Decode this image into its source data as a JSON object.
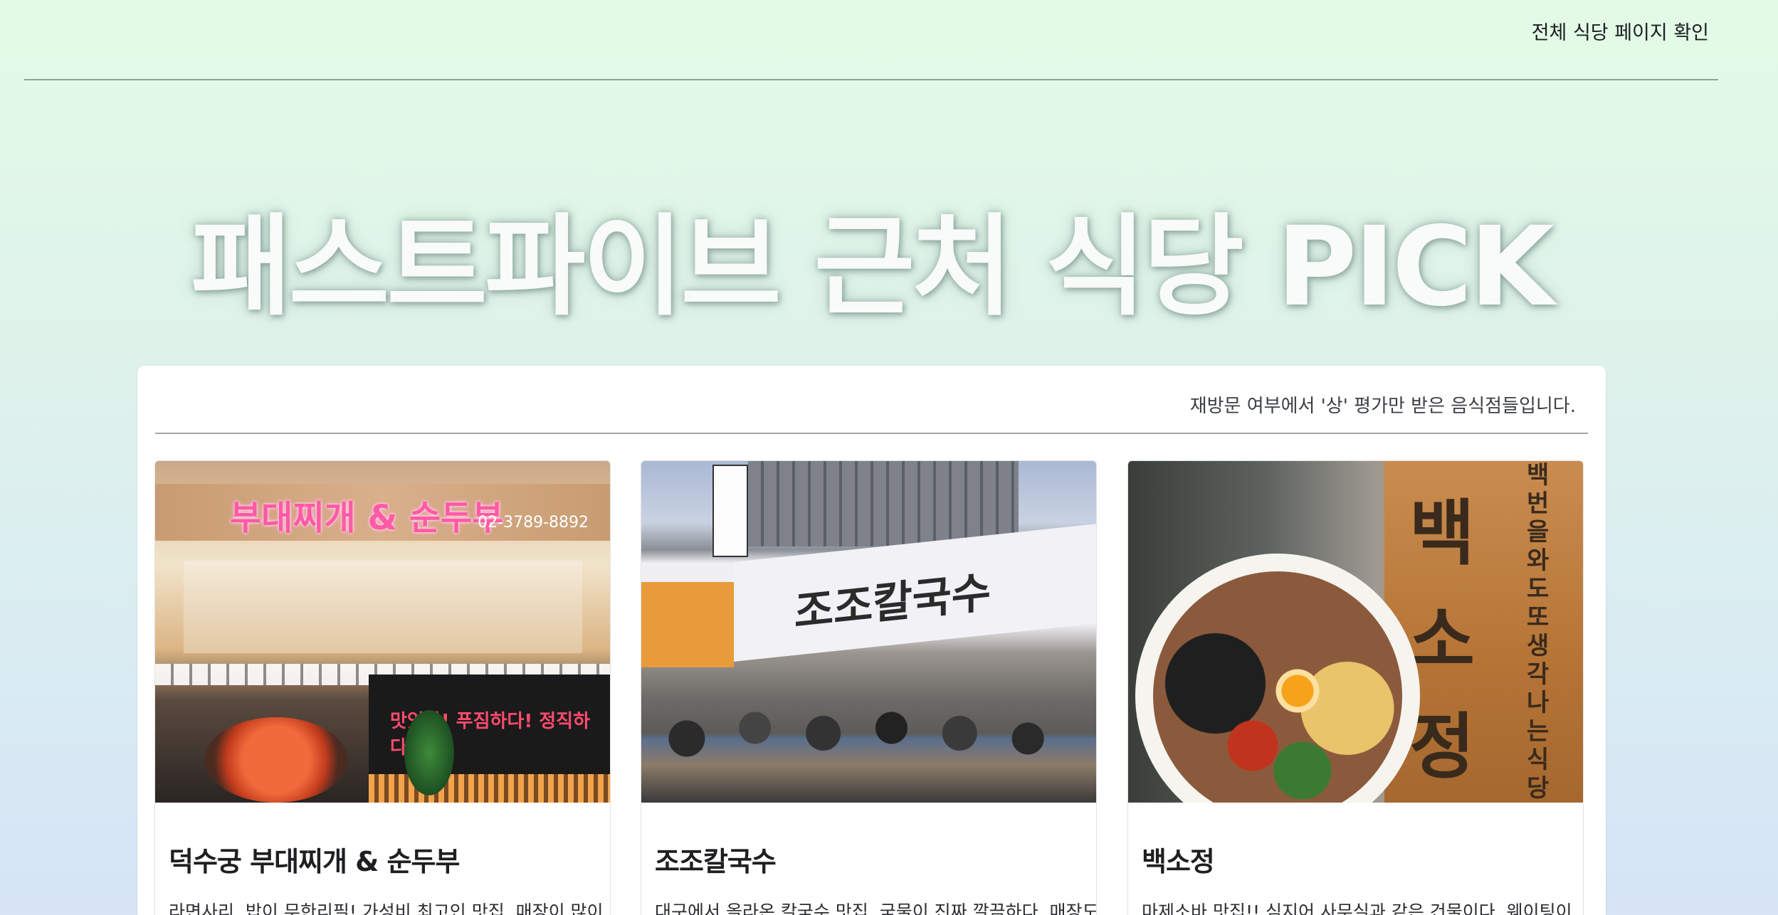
{
  "nav": {
    "link_label": "전체 식당 페이지 확인"
  },
  "hero": {
    "title": "패스트파이브 근처 식당 PICK"
  },
  "panel": {
    "subtitle": "재방문 여부에서 '상' 평가만 받은 음식점들입니다."
  },
  "cards": [
    {
      "title": "덕수궁 부대찌개 & 순두부",
      "description": "라면사리, 밥이 무한리필! 가성비 최고인 맛집. 매장이 많이",
      "image_sign": "부대찌개 & 순두부",
      "image_phone": "02-3789-8892",
      "image_board": "맛있다! 푸짐하다! 정직하다!"
    },
    {
      "title": "조조칼국수",
      "description": "대구에서 올라온 칼국수 맛집. 국물이 진짜 깔끔하다. 매장도",
      "image_sign": "조조칼국수"
    },
    {
      "title": "백소정",
      "description": "마제소바 맛집!! 심지어 사무실과 같은 건물이다. 웨이팅이",
      "image_sign_1": "백",
      "image_sign_2": "소",
      "image_sign_3": "정",
      "image_vertical": "백번을와도또생각나는식당"
    }
  ],
  "colors": {
    "bg_top": "#e3fbe6",
    "bg_bottom": "#d6e4f6",
    "panel_bg": "#ffffff",
    "divider": "#a6a6a6"
  }
}
